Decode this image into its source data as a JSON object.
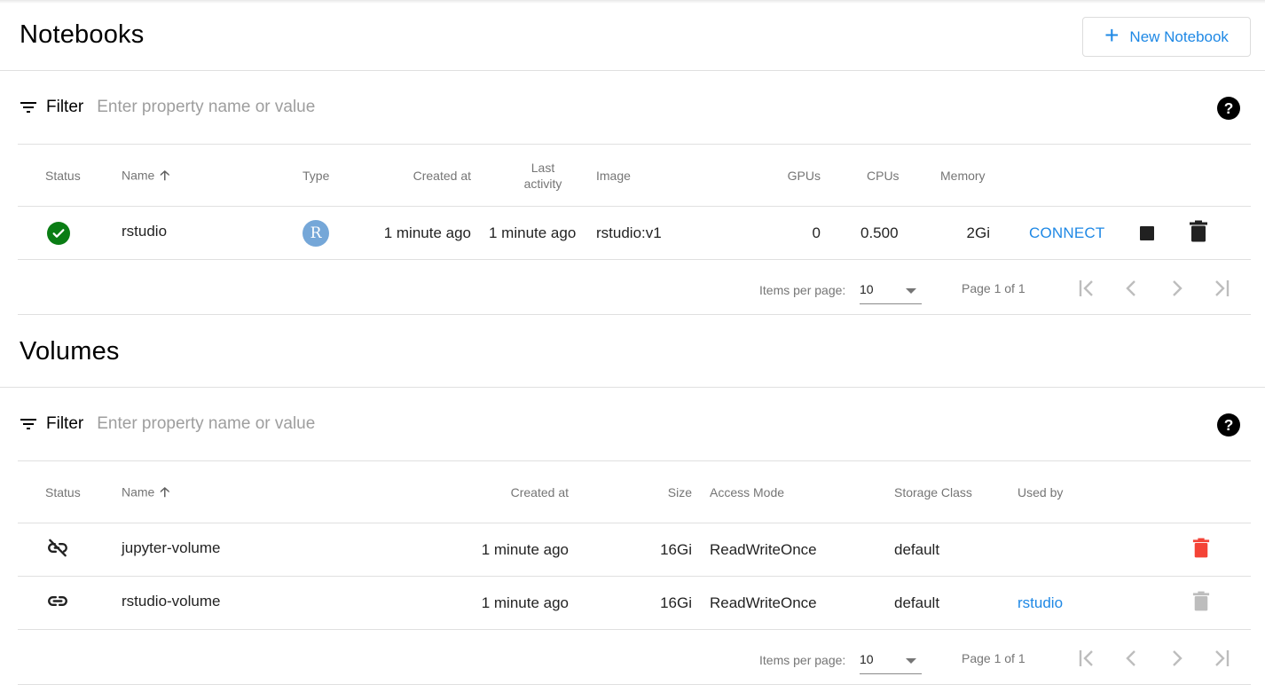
{
  "notebooks": {
    "title": "Notebooks",
    "new_button_label": "New Notebook",
    "filter": {
      "label": "Filter",
      "placeholder": "Enter property name or value",
      "value": ""
    },
    "columns": {
      "status": "Status",
      "name": "Name",
      "type": "Type",
      "created_at": "Created at",
      "last_activity": "Last activity",
      "image": "Image",
      "gpus": "GPUs",
      "cpus": "CPUs",
      "memory": "Memory"
    },
    "sort": {
      "column": "Name",
      "direction": "ascending"
    },
    "rows": [
      {
        "status": "ready",
        "status_icon": "check-circle-icon",
        "name": "rstudio",
        "type_icon": "R",
        "created_at": "1 minute ago",
        "last_activity": "1 minute ago",
        "image": "rstudio:v1",
        "gpus": "0",
        "cpus": "0.500",
        "memory": "2Gi",
        "connect_label": "CONNECT"
      }
    ],
    "paginator": {
      "items_per_page_label": "Items per page:",
      "items_per_page": "10",
      "range_label": "Page 1 of 1"
    }
  },
  "volumes": {
    "title": "Volumes",
    "filter": {
      "label": "Filter",
      "placeholder": "Enter property name or value",
      "value": ""
    },
    "columns": {
      "status": "Status",
      "name": "Name",
      "created_at": "Created at",
      "size": "Size",
      "access_mode": "Access Mode",
      "storage_class": "Storage Class",
      "used_by": "Used by"
    },
    "sort": {
      "column": "Name",
      "direction": "ascending"
    },
    "rows": [
      {
        "status": "unattached",
        "status_icon": "link-off-icon",
        "name": "jupyter-volume",
        "created_at": "1 minute ago",
        "size": "16Gi",
        "access_mode": "ReadWriteOnce",
        "storage_class": "default",
        "used_by": "",
        "delete_enabled": true
      },
      {
        "status": "attached",
        "status_icon": "link-icon",
        "name": "rstudio-volume",
        "created_at": "1 minute ago",
        "size": "16Gi",
        "access_mode": "ReadWriteOnce",
        "storage_class": "default",
        "used_by": "rstudio",
        "delete_enabled": false
      }
    ],
    "paginator": {
      "items_per_page_label": "Items per page:",
      "items_per_page": "10",
      "range_label": "Page 1 of 1"
    }
  },
  "colors": {
    "accent": "#1e88e5",
    "status_ok": "#0a7d14",
    "delete_active": "#f44336",
    "delete_disabled": "#bdbdbd",
    "r_avatar": "#75a7d8"
  }
}
